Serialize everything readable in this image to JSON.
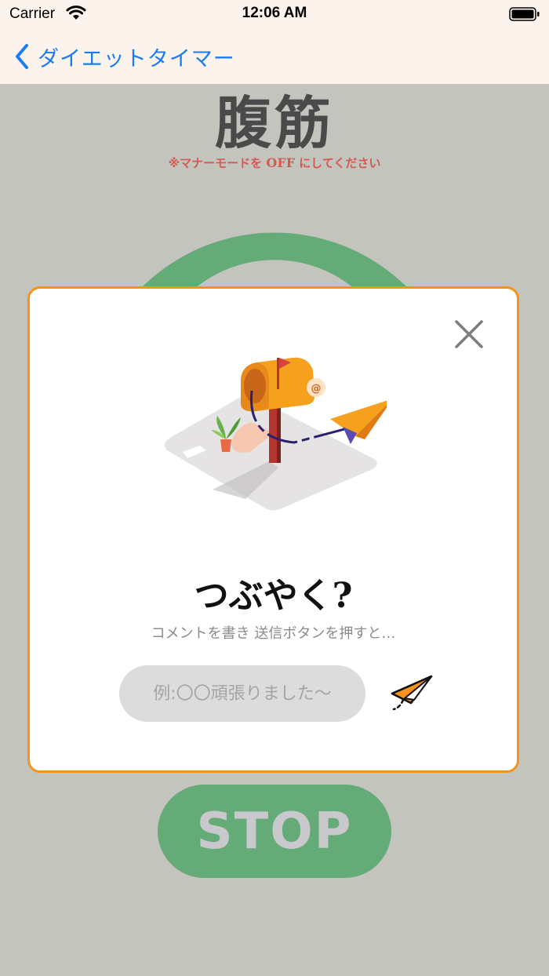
{
  "status_bar": {
    "carrier": "Carrier",
    "time": "12:06 AM",
    "icons": [
      "wifi-icon",
      "battery-icon"
    ]
  },
  "nav": {
    "back_label": "ダイエットタイマー",
    "back_icon": "chevron-left-icon",
    "accent_color": "#1a7cf5"
  },
  "screen": {
    "exercise_title": "腹筋",
    "manner_note_prefix": "※マナーモードを ",
    "manner_note_off": "OFF",
    "manner_note_suffix": " にしてください",
    "stop_label": "STOP",
    "ring_color": "#64ab77",
    "background_color": "#c4c4bf"
  },
  "modal": {
    "close_icon": "close-icon",
    "illustration": "mailbox-paper-plane-illustration",
    "title": "つぶやく",
    "title_mark": "?",
    "subtitle": "コメントを書き 送信ボタンを押すと…",
    "input_value": "",
    "input_placeholder": "例:〇〇頑張りました〜",
    "send_icon": "paper-plane-icon",
    "border_color": "#f5941d"
  }
}
